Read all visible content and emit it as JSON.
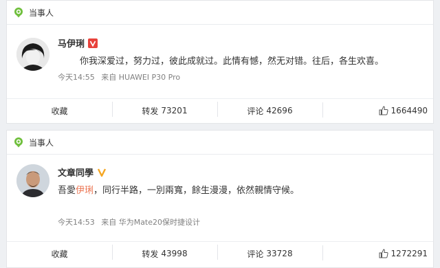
{
  "posts": [
    {
      "tag": "当事人",
      "author": "马伊琍",
      "content_parts": [
        "你我深爱过，努力过，彼此成就过。此情有憾，然无对错。往后，各生欢喜。"
      ],
      "time": "今天14:55",
      "source": "来自 HUAWEI P30 Pro",
      "actions": {
        "favorite": "收藏",
        "repost_label": "转发",
        "repost_count": "73201",
        "comment_label": "评论",
        "comment_count": "42696",
        "like_count": "1664490"
      }
    },
    {
      "tag": "当事人",
      "author": "文章同學",
      "content_pre": "吾愛",
      "content_link": "伊琍",
      "content_post": "，同行半路，一別兩寬，餘生漫漫，依然親情守候。",
      "time": "今天14:53",
      "source": "来自 华为Mate20保时捷设计",
      "actions": {
        "favorite": "收藏",
        "repost_label": "转发",
        "repost_count": "43998",
        "comment_label": "评论",
        "comment_count": "33728",
        "like_count": "1272291"
      }
    }
  ],
  "colors": {
    "accent": "#eb7350",
    "tag_icon": "#6fbf3c",
    "verified": "#f5a623"
  }
}
